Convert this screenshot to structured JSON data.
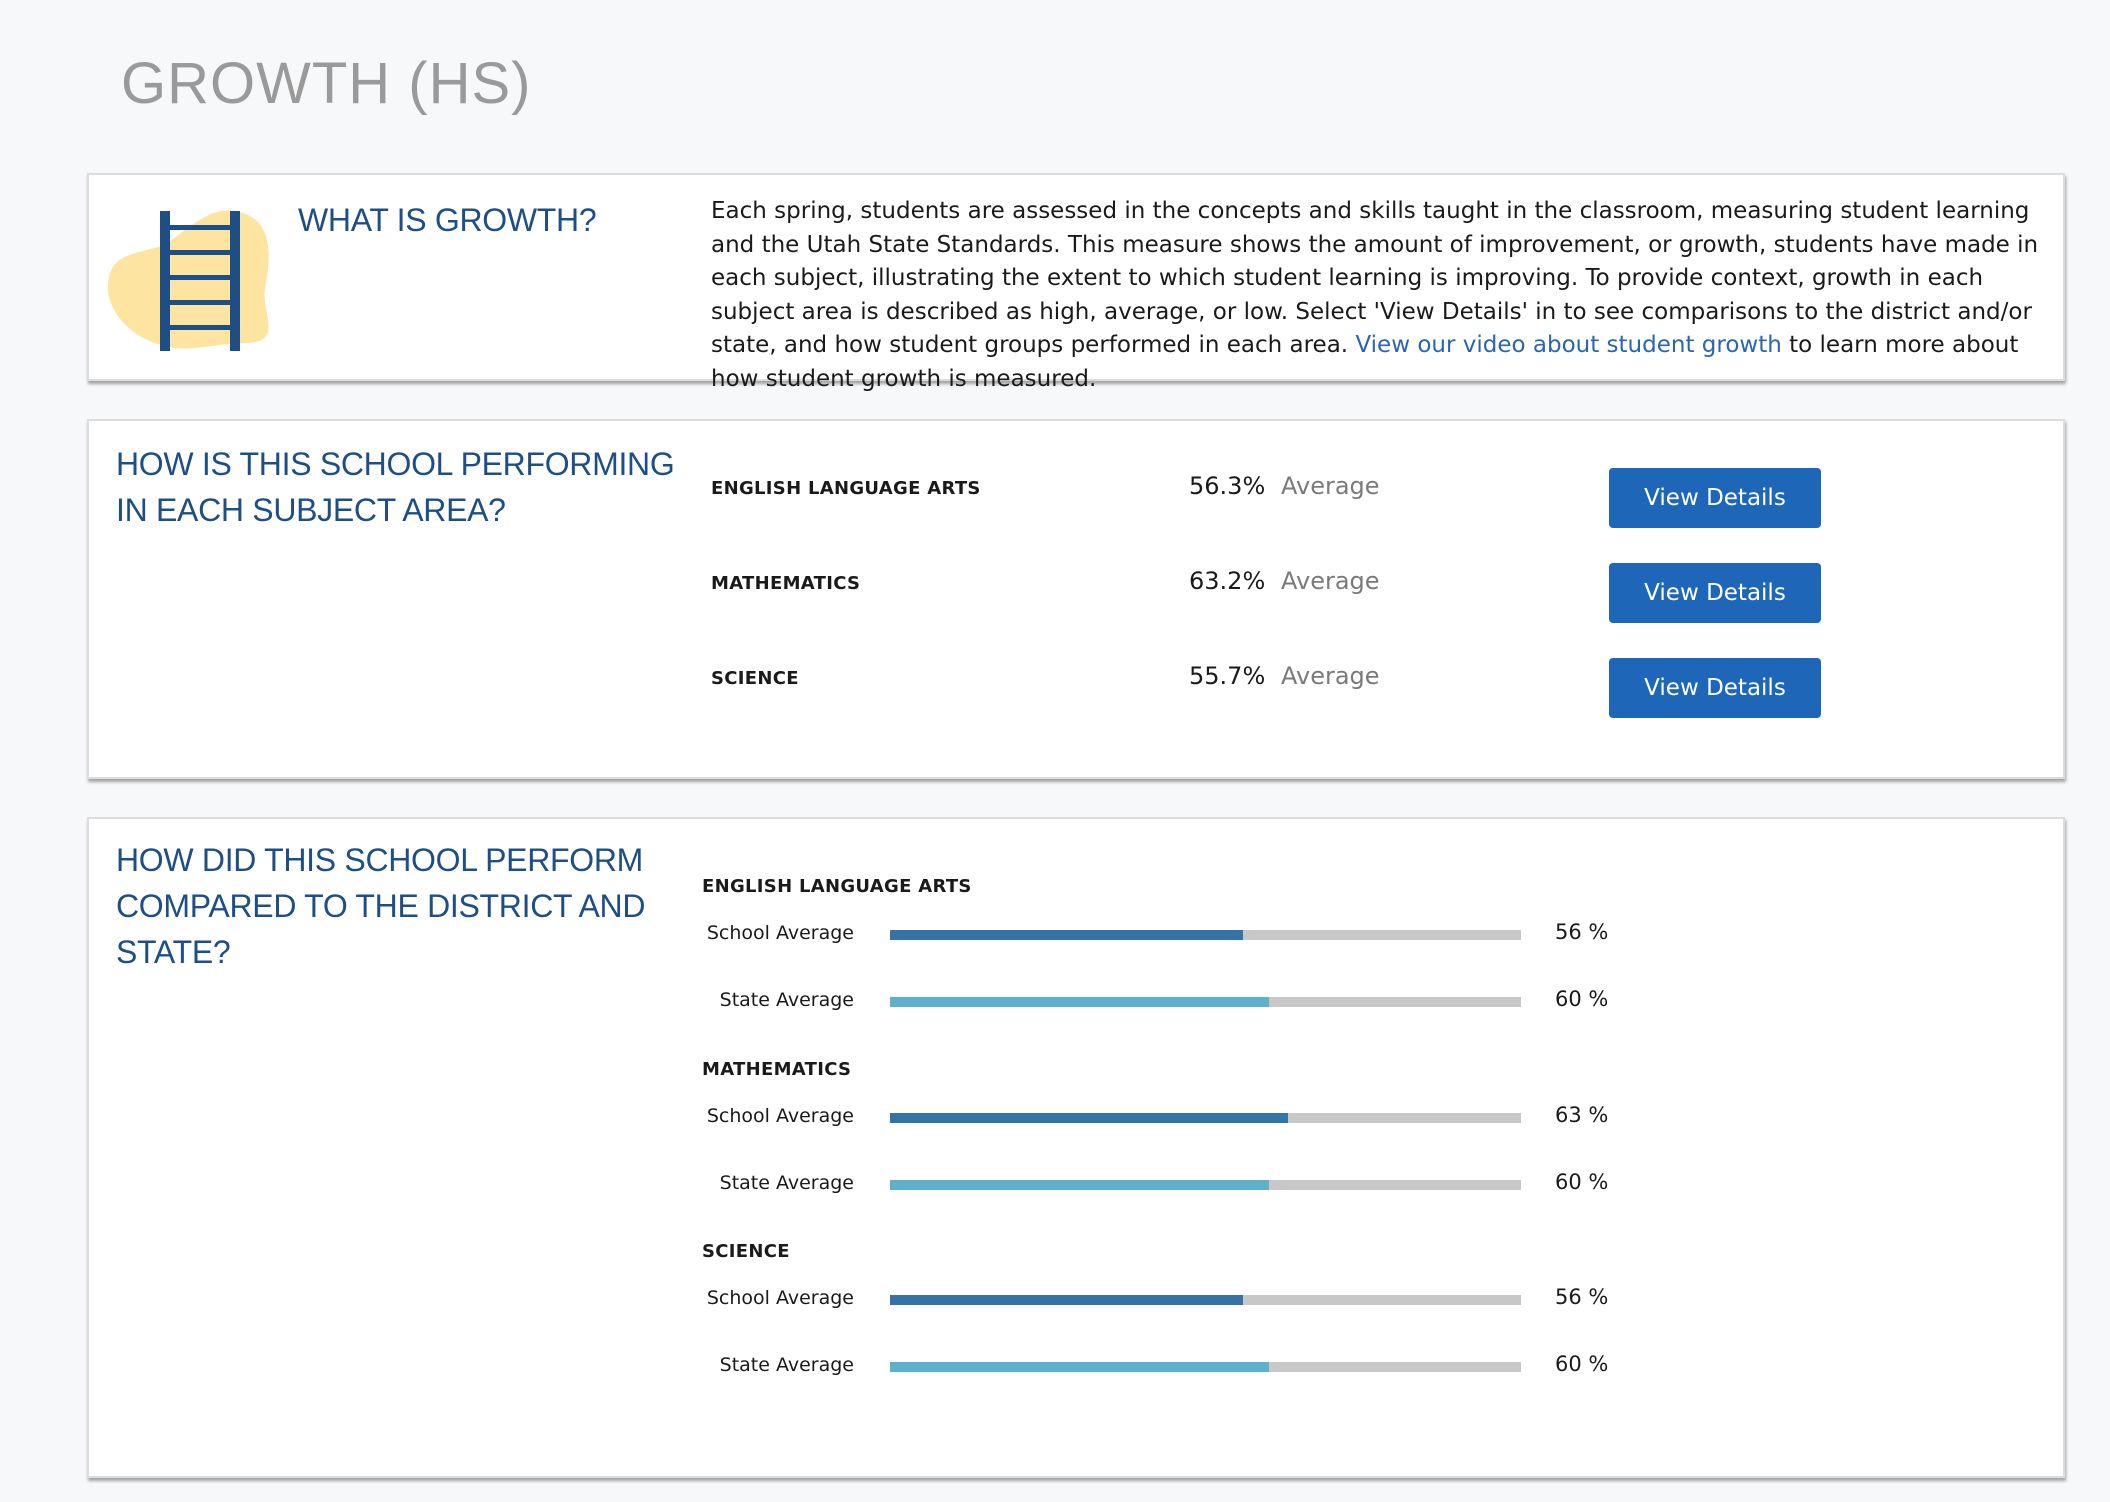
{
  "page": {
    "title": "GROWTH (HS)"
  },
  "intro": {
    "heading": "WHAT IS GROWTH?",
    "text": "Each spring, students are assessed in the concepts and skills taught in the classroom, measuring student learning and the Utah State Standards. This measure shows the amount of improvement, or growth, students have made in each subject, illustrating the extent to which student learning is improving. To provide context, growth in each subject area is described as high, average, or low. Select 'View Details' in to see comparisons to the district and/or state, and how student groups performed in each area.",
    "link_text": "View our video about student growth",
    "link_suffix": " to learn more about how student growth is measured.",
    "icon": "ladder-icon",
    "colors": {
      "ladder": "#1d4f85",
      "blob": "#fde4a0"
    }
  },
  "performance": {
    "heading": "HOW IS THIS SCHOOL PERFORMING IN EACH SUBJECT AREA?",
    "subjects": [
      {
        "name": "ENGLISH LANGUAGE ARTS",
        "percent": "56.3%",
        "level": "Average",
        "button": "View Details"
      },
      {
        "name": "MATHEMATICS",
        "percent": "63.2%",
        "level": "Average",
        "button": "View Details"
      },
      {
        "name": "SCIENCE",
        "percent": "55.7%",
        "level": "Average",
        "button": "View Details"
      }
    ]
  },
  "comparison": {
    "heading": "HOW DID THIS SCHOOL PERFORM COMPARED TO THE DISTRICT AND STATE?",
    "colors": {
      "school": "#3572a8",
      "state": "#5eb0cd",
      "track": "#c8c8c8"
    },
    "subjects": [
      {
        "name": "ENGLISH LANGUAGE ARTS",
        "rows": [
          {
            "label": "School Average",
            "value": 56,
            "display": "56 %",
            "kind": "school"
          },
          {
            "label": "State Average",
            "value": 60,
            "display": "60 %",
            "kind": "state"
          }
        ]
      },
      {
        "name": "MATHEMATICS",
        "rows": [
          {
            "label": "School Average",
            "value": 63,
            "display": "63 %",
            "kind": "school"
          },
          {
            "label": "State Average",
            "value": 60,
            "display": "60 %",
            "kind": "state"
          }
        ]
      },
      {
        "name": "SCIENCE",
        "rows": [
          {
            "label": "School Average",
            "value": 56,
            "display": "56 %",
            "kind": "school"
          },
          {
            "label": "State Average",
            "value": 60,
            "display": "60 %",
            "kind": "state"
          }
        ]
      }
    ]
  }
}
